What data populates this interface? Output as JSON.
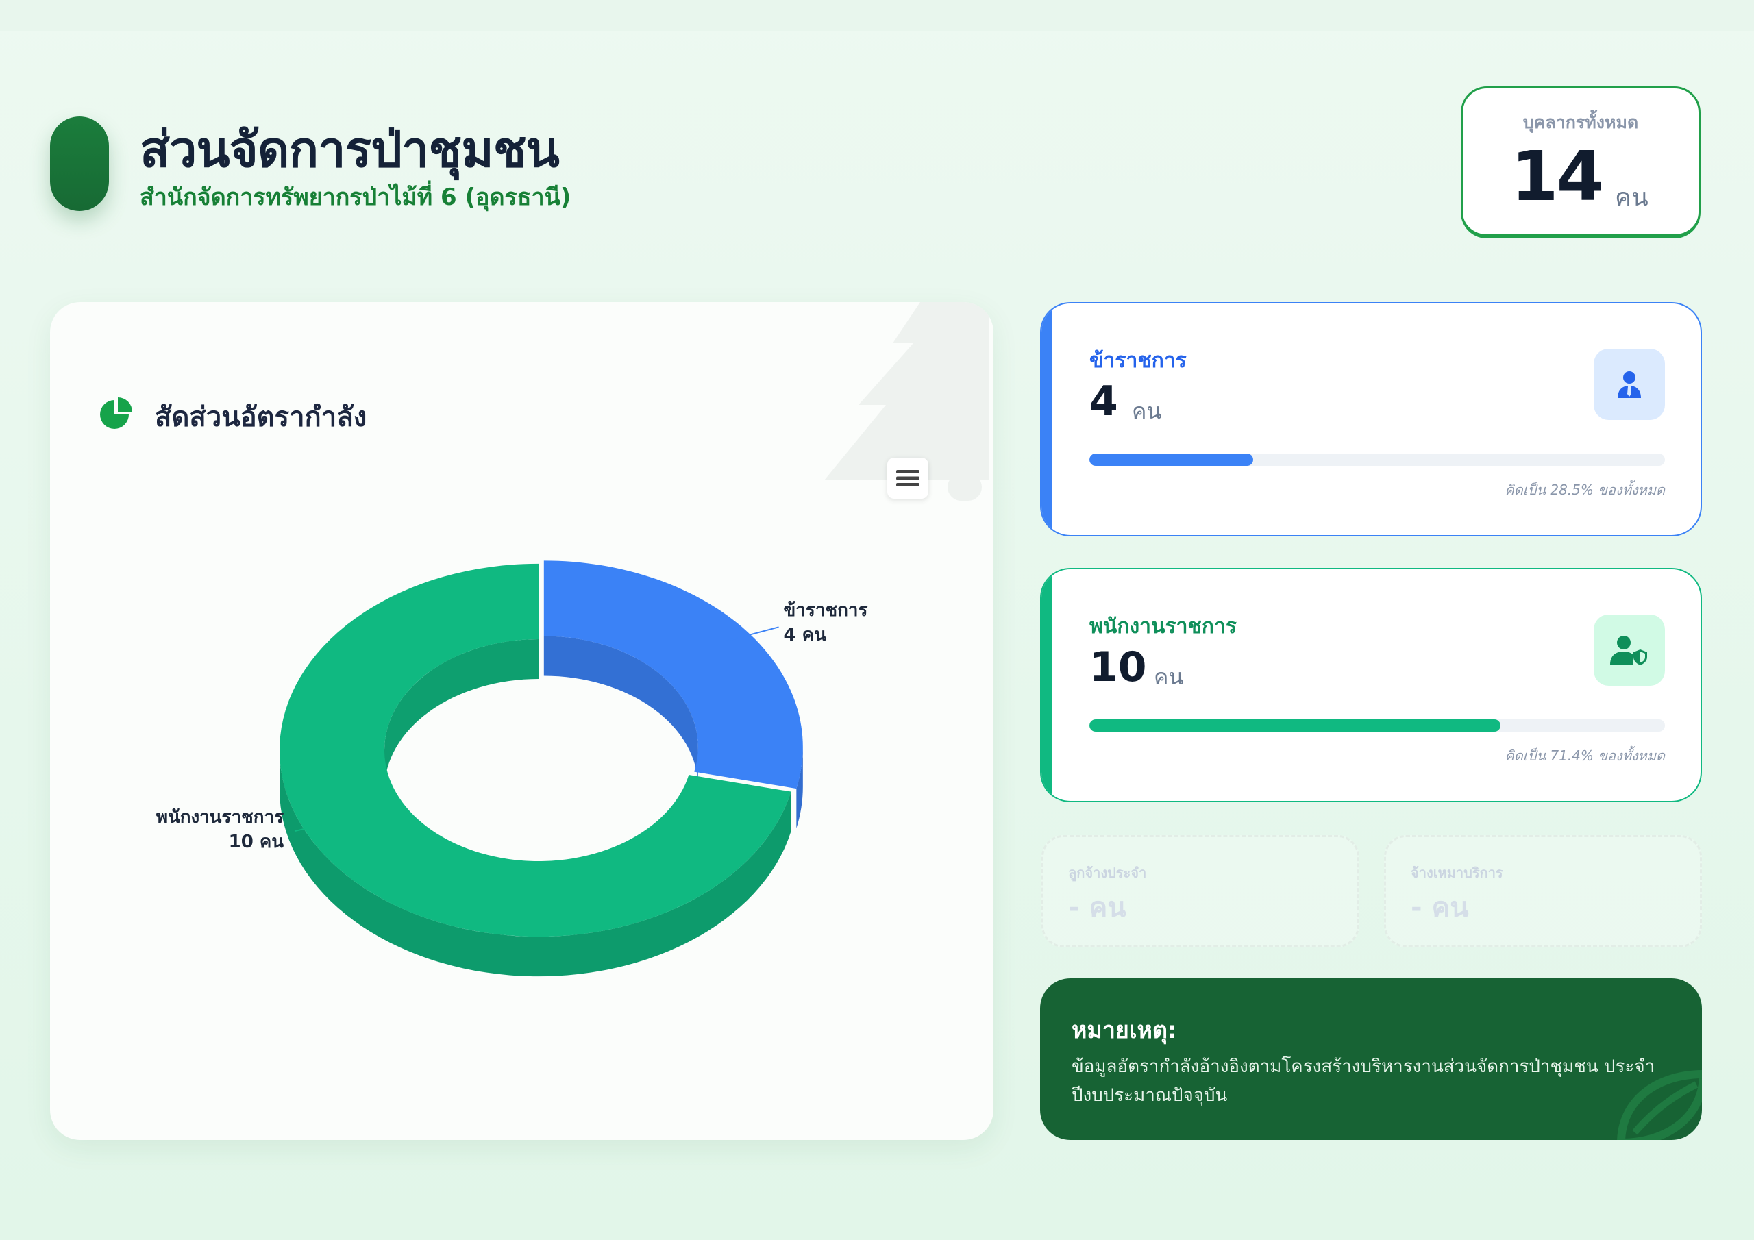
{
  "header": {
    "title": "ส่วนจัดการป่าชุมชน",
    "subtitle": "สำนักจัดการทรัพยากรป่าไม้ที่ 6 (อุดรธานี)",
    "total_label": "บุคลากรทั้งหมด",
    "total_value": "14",
    "total_unit": "คน"
  },
  "chart_panel": {
    "heading": "สัดส่วนอัตรากำลัง",
    "menu_icon": "hamburger-menu-icon"
  },
  "chart_data": {
    "type": "pie",
    "categories": [
      "ข้าราชการ",
      "พนักงานราชการ"
    ],
    "values": [
      4,
      10
    ],
    "labels": [
      {
        "name": "ข้าราชการ",
        "value_text": "4 คน"
      },
      {
        "name": "พนักงานราชการ",
        "value_text": "10 คน"
      }
    ],
    "colors": [
      "#3b82f6",
      "#10b981"
    ],
    "donut": true,
    "style": "3d"
  },
  "cards": {
    "gov": {
      "label": "ข้าราชการ",
      "value": "4",
      "unit": "คน",
      "percent": 28.5,
      "note": "คิดเป็น 28.5% ของทั้งหมด",
      "icon": "user-tie-icon",
      "color": "#3b82f6"
    },
    "emp": {
      "label": "พนักงานราชการ",
      "value": "10",
      "unit": "คน",
      "percent": 71.4,
      "note": "คิดเป็น 71.4% ของทั้งหมด",
      "icon": "user-shield-icon",
      "color": "#10b981"
    },
    "contract": {
      "label": "ลูกจ้างประจำ",
      "value": "- คน"
    },
    "service": {
      "label": "จ้างเหมาบริการ",
      "value": "- คน"
    }
  },
  "note": {
    "title": "หมายเหตุ:",
    "text": "ข้อมูลอัตรากำลังอ้างอิงตามโครงสร้างบริหารงานส่วนจัดการป่าชุมชน ประจำปีงบประมาณปัจจุบัน"
  }
}
